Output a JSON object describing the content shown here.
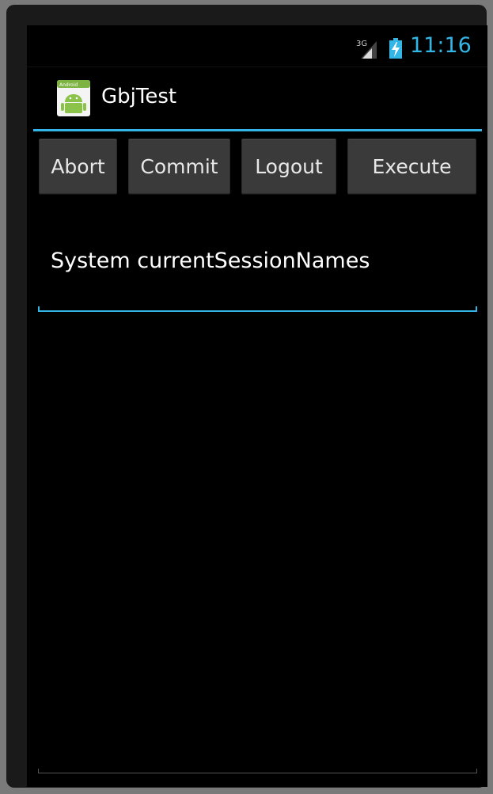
{
  "status_bar": {
    "network_type": "3G",
    "time": "11:16",
    "accent_color": "#33b5e5"
  },
  "action_bar": {
    "title": "GbjTest",
    "icon_label": "Android"
  },
  "buttons": {
    "abort": "Abort",
    "commit": "Commit",
    "logout": "Logout",
    "execute": "Execute"
  },
  "input": {
    "value": "System currentSessionNames"
  },
  "output": {
    "value": ""
  }
}
